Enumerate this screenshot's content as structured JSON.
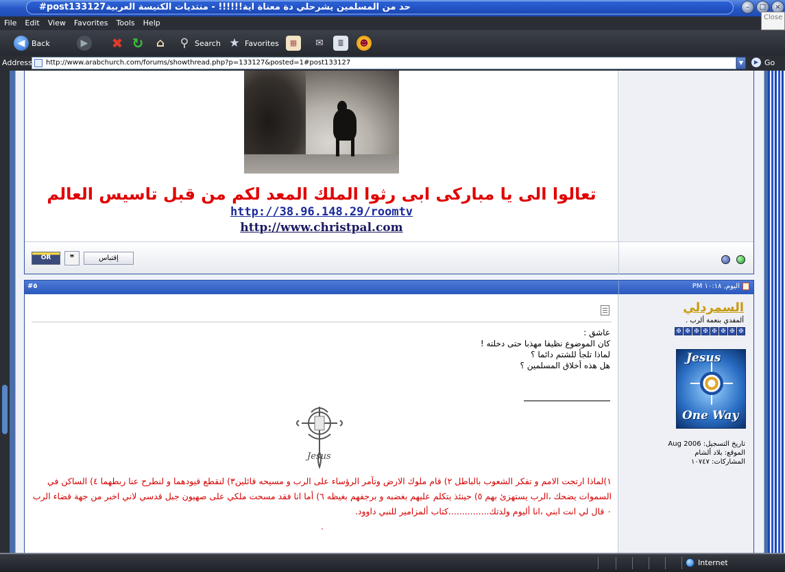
{
  "window": {
    "title": "#post133127حد من المسلمين يشرحلي دة معناة اية!!!!!! - منتديات الكنيسة العربية",
    "close_tooltip": "Close"
  },
  "menu": [
    "File",
    "Edit",
    "View",
    "Favorites",
    "Tools",
    "Help"
  ],
  "toolbar": {
    "back_label": "Back",
    "search_label": "Search",
    "favorites_label": "Favorites"
  },
  "address": {
    "label": "Address",
    "url": "http://www.arabchurch.com/forums/showthread.php?p=133127&posted=1#post133127",
    "go_label": "Go"
  },
  "post1": {
    "title": "تعالوا الى يا مباركى ابى رثوا الملك المعد لكم من قبل تاسيس العالم",
    "link1": "http://38.96.148.29/roomtv",
    "link2": "http://www.christpal.com",
    "quote_button": "إقتباس",
    "multiquote_icon": "multiquote-icon",
    "online_button_text": "OR"
  },
  "post2": {
    "number": "#٥",
    "date": "اليوم, ١٠:١٨ PM",
    "username": "السمردلي",
    "user_title": "ألمفدي بنعمة ألرب .",
    "avatar_text_top": "Jesus",
    "avatar_text_bottom": "One Way",
    "join_date": "تاريخ التسجيل: Aug 2006",
    "location": "الموقع: بلاد ألشام",
    "posts": "المشاركات: ١٠٧٤٧",
    "message_lines": [
      "عاشق :",
      "كان الموضوع نظيفا مهذبا حتى دخلته !",
      "لماذا تلجأ للشتم دائما ؟",
      "هل هذه أخلاق المسلمين ؟"
    ],
    "signature_red": "١)لماذا ارتجت الامم و تفكر الشعوب بالباطل ٢) قام ملوك الارض وتآمر الرؤساء على الرب و مسيحه قائلين٣) لنقطع قيودهما و لنطرح عنا ربطهما ٤) الساكن في السموات يضحك ،الرب يستهزئ بهم ٥) حينئذ يتكلم عليهم بغضبه و برجفهم بغيظه ٦) أما انا فقد مسحت ملكي على صهيون جبل قدسي لاني اخبر من جهة قضاء الرب ٠ قال لي انت ابني ،انا أليوم ولدتك...............كتاب ألمزامير للنبي داوود.",
    "signature_dot": "."
  },
  "status": {
    "zone": "Internet"
  },
  "icons": {
    "back": "back-arrow-icon",
    "forward": "forward-arrow-icon",
    "stop": "stop-icon",
    "refresh": "refresh-icon",
    "home": "home-icon",
    "search": "search-icon",
    "favorites": "favorites-star-icon",
    "history": "history-icon",
    "mail": "mail-icon",
    "print": "print-icon",
    "messenger": "messenger-icon"
  }
}
